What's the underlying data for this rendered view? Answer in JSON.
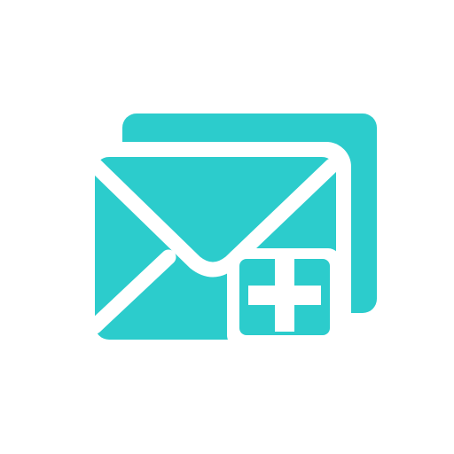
{
  "icon": {
    "name": "add-mail-icon",
    "colors": {
      "accent": "#2ccccc",
      "background": "#ffffff",
      "stroke": "#ffffff"
    }
  }
}
